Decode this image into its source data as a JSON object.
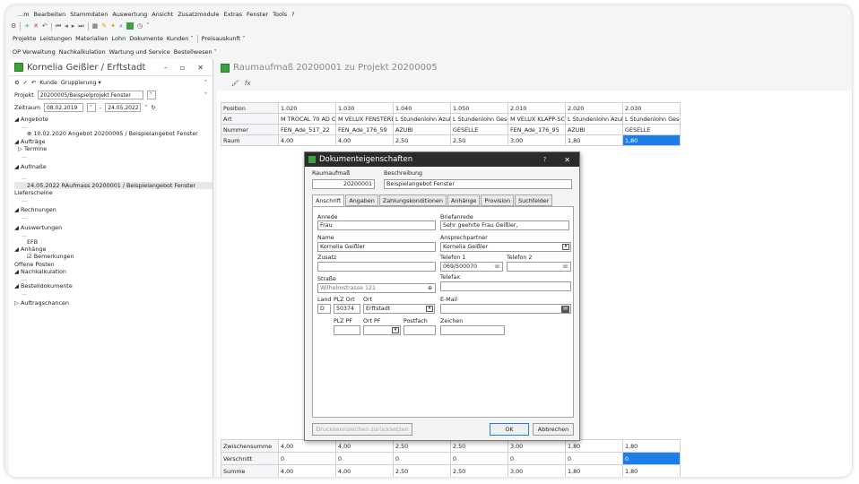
{
  "menu": [
    "...m",
    "Bearbeiten",
    "Stammdaten",
    "Auswertung",
    "Ansicht",
    "Zusatzmodule",
    "Extras",
    "Fenster",
    "Tools",
    "?"
  ],
  "toolbar2": [
    "Projekte",
    "Leistungen",
    "Materialien",
    "Lohn",
    "Dokumente",
    "Kunden ˅",
    "Preisauskunft ˅"
  ],
  "toolbar3": [
    "OP Verwaltung",
    "Nachkalkulation",
    "Wartung und Service",
    "Bestellwesen ˅"
  ],
  "left": {
    "title": "Kornelia Geißler / Erftstadt",
    "win_min": "–",
    "win_max": "▫",
    "win_close": "✕",
    "tool_kunde": "Kunde",
    "tool_gruppierung": "Gruppierung ▾",
    "projekt_label": "Projekt",
    "projekt_value": "20200005/Beispielprojekt Fenster",
    "zeitraum_label": "Zeitraum",
    "zeitraum_from": "08.02.2019",
    "zeitraum_to": "24.05.2022",
    "tree": {
      "angebote": "◢ Angebote",
      "angebote_dots": "...",
      "angebote_item": "⊕ 10.02.2020 Angebot 20200005 / Beispielangebot Fenster",
      "auftraege": "◢ Aufträge",
      "termine": "▷ Termine",
      "termine_dots": "...",
      "aufmasse": "◢ Aufmaße",
      "aufmasse_dots": "...",
      "aufmasse_item": "24.05.2022 RAufmass 20200001 / Beispielangebot Fenster",
      "lieferscheine": "Lieferscheine",
      "lieferscheine_dots": "...",
      "rechnungen": "◢ Rechnungen",
      "rechnungen_dots": "...",
      "auswertungen": "◢ Auswertungen",
      "auswertungen_dots": "...",
      "efb": "EFB",
      "anhaenge": "◢ Anhänge",
      "bemerkungen": "☑ Bemerkungen",
      "offene_posten": "Offene Posten",
      "nachkalkulation": "◢ Nachkalkulation",
      "nachkalkulation_dots": "...",
      "bestelldokumente": "◢ Bestelldokumente",
      "bestelldokumente_dots": "...",
      "auftragschancen": "▷ Auftragschancen"
    }
  },
  "right": {
    "title": "Raumaufmaß 20200001 zu Projekt 20200005",
    "fx": "fx",
    "grid": {
      "rows": [
        {
          "label": "Position",
          "cells": [
            "1.020",
            "1.030",
            "1.040",
            "1.050",
            "2.010",
            "2.020",
            "2.030"
          ]
        },
        {
          "label": "Art",
          "cells": [
            "M TROCAL 70 AD C",
            "M VELUX FENSTERE",
            "L Stundenlohn Azubi",
            "L Stundenlohn Gese",
            "M VELUX KLAPP-SC",
            "L Stundenlohn Azubi",
            "L Stundenlohn Gese"
          ]
        },
        {
          "label": "Nummer",
          "cells": [
            "FEN_Ade_517_22",
            "FEN_Ade_176_59",
            "AZUBI",
            "GESELLE",
            "FEN_Ade_176_95",
            "AZUBI",
            "GESELLE"
          ]
        },
        {
          "label": "Raum",
          "cells": [
            "4,00",
            "4,00",
            "2,50",
            "2,50",
            "3,00",
            "1,80",
            "1,80"
          ]
        }
      ],
      "bottom": [
        {
          "label": "Zwischensumme",
          "cells": [
            "4,00",
            "4,00",
            "2,50",
            "2,50",
            "3,00",
            "1,80",
            "1,80"
          ]
        },
        {
          "label": "Verschnitt",
          "cells": [
            "0",
            "0",
            "0",
            "0",
            "0",
            "0",
            "0"
          ]
        },
        {
          "label": "Summe",
          "cells": [
            "4,00",
            "4,00",
            "2,50",
            "2,50",
            "3,00",
            "1,80",
            "1,80"
          ]
        }
      ]
    }
  },
  "dialog": {
    "title": "Dokumenteigenschaften",
    "help": "?",
    "close": "✕",
    "raumaufmass_label": "Raumaufmaß",
    "raumaufmass_value": "20200001",
    "beschreibung_label": "Beschreibung",
    "beschreibung_value": "Beispielangebot Fenster",
    "tabs": [
      "Anschrift",
      "Angaben",
      "Zahlungskonditionen",
      "Anhänge",
      "Provision",
      "Suchfelder"
    ],
    "anrede_label": "Anrede",
    "anrede_value": "Frau",
    "briefanrede_label": "Briefanrede",
    "briefanrede_value": "Sehr geehrte Frau Geißler,",
    "name_label": "Name",
    "name_value": "Kornelia Geißler",
    "ansprechpartner_label": "Ansprechpartner",
    "ansprechpartner_value": "Kornelia Geißler",
    "zusatz_label": "Zusatz",
    "telefon1_label": "Telefon 1",
    "telefon1_value": "069/500070",
    "telefon2_label": "Telefon 2",
    "telefax_label": "Telefax",
    "strasse_label": "Straße",
    "strasse_value": "Wilhelmstrasse 121",
    "land_label": "Land",
    "land_value": "D",
    "plz_ort_label": "PLZ Ort",
    "plz_value": "50374",
    "ort_label": "Ort",
    "ort_value": "Erftstadt",
    "email_label": "E-Mail",
    "plz_pf_label": "PLZ PF",
    "ort_pf_label": "Ort PF",
    "postfach_label": "Postfach",
    "zeichen_label": "Zeichen",
    "reset_button": "Druckkennzeichen zurücksetzen",
    "ok_button": "OK",
    "cancel_button": "Abbrechen"
  }
}
